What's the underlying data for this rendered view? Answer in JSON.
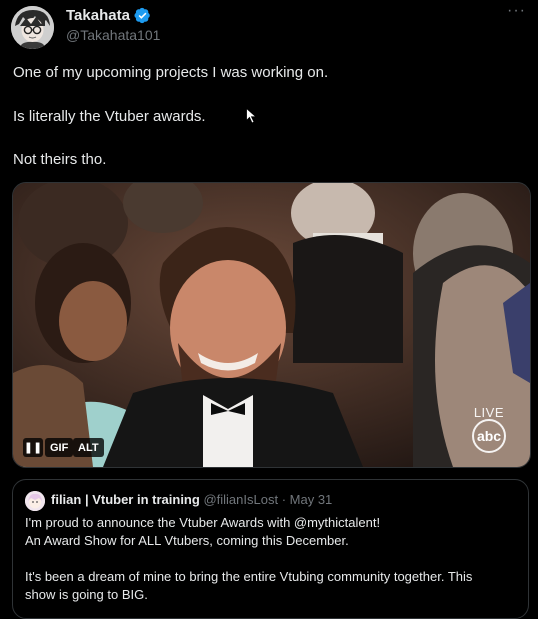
{
  "author": {
    "display_name": "Takahata",
    "handle": "@Takahata101"
  },
  "more_label": "···",
  "tweet_text": {
    "line1": "One of my upcoming projects I was working on.",
    "line2": "Is literally the Vtuber awards.",
    "line3": "Not theirs tho."
  },
  "media": {
    "pause_label": "❚❚",
    "gif_label": "GIF",
    "alt_label": "ALT",
    "live_label": "LIVE",
    "network_logo": "abc"
  },
  "quote": {
    "display_name": "filian | Vtuber in training",
    "handle": "@filianIsLost",
    "separator": "·",
    "date": "May 31",
    "line1": "I'm proud to announce the Vtuber Awards with @mythictalent!",
    "line2": "An Award Show for ALL Vtubers, coming this December.",
    "line3": "It's been a dream of mine to bring the entire Vtubing community together. This",
    "line4": "show is going to BIG."
  },
  "colors": {
    "background": "#000000",
    "text": "#e7e9ea",
    "secondary": "#71767b",
    "verified": "#1d9bf0",
    "border": "#2f3336"
  }
}
